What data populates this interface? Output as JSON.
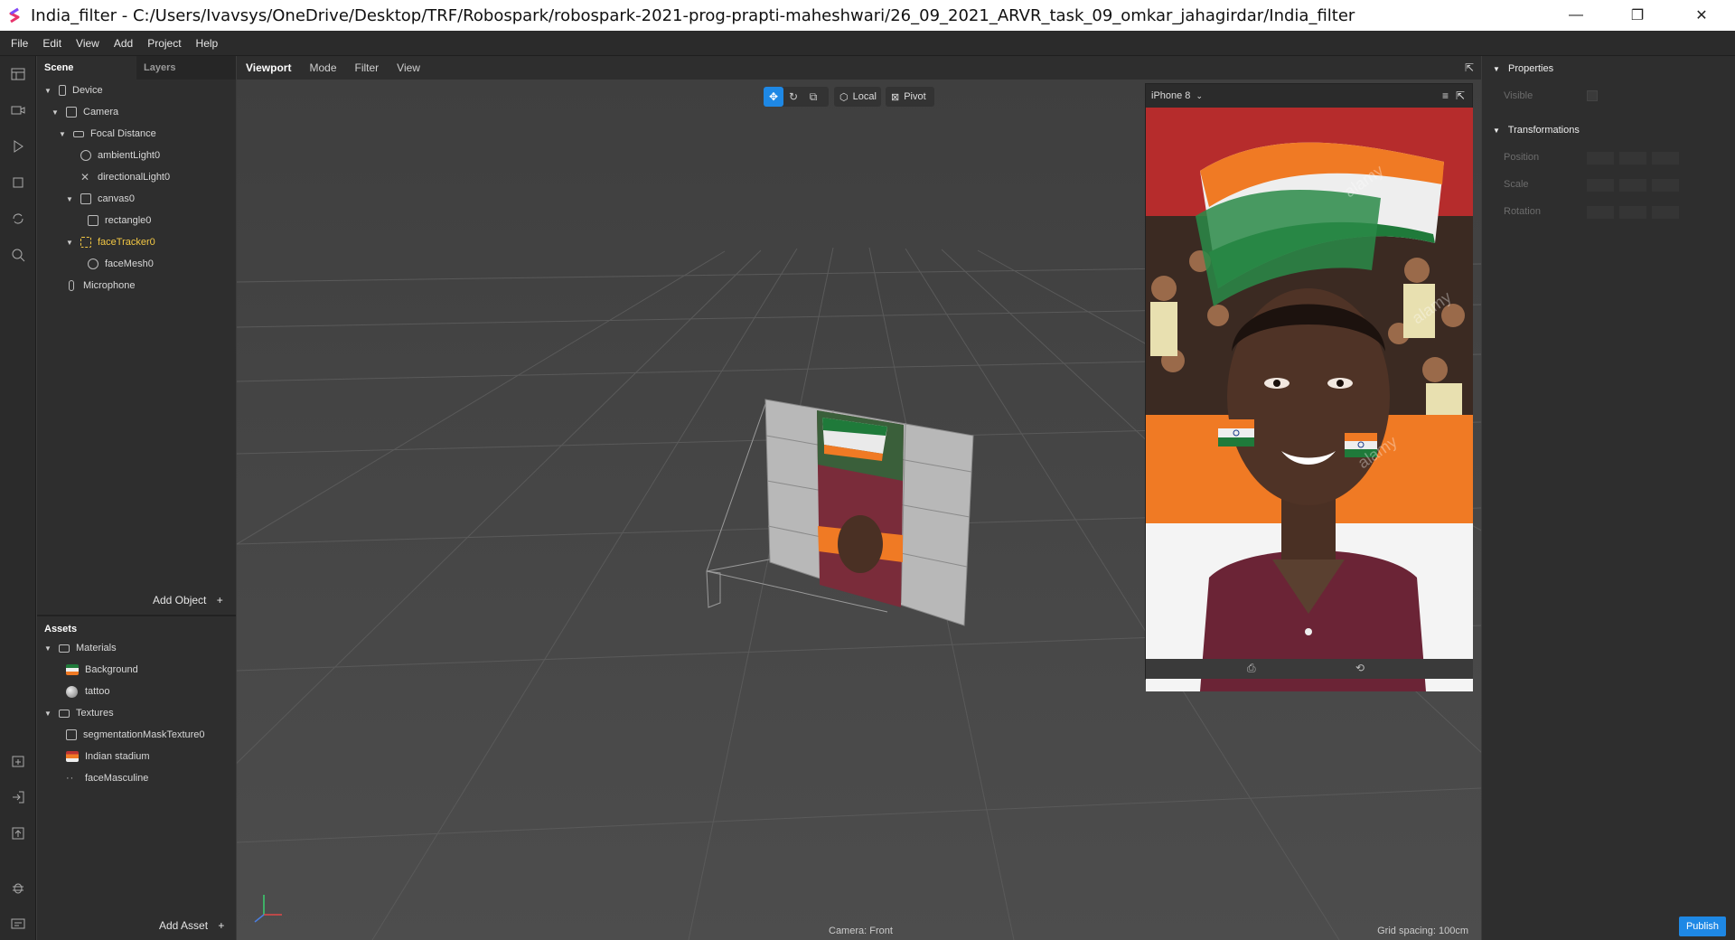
{
  "window": {
    "title": "India_filter - C:/Users/Ivavsys/OneDrive/Desktop/TRF/Robospark/robospark-2021-prog-prapti-maheshwari/26_09_2021_ARVR_task_09_omkar_jahagirdar/India_filter",
    "minimize": "—",
    "restore": "❐",
    "close": "✕"
  },
  "menu": [
    "File",
    "Edit",
    "View",
    "Add",
    "Project",
    "Help"
  ],
  "scene_panel": {
    "tabs": [
      "Scene",
      "Layers"
    ],
    "tree": [
      {
        "label": "Device",
        "icon": "device-icon"
      },
      {
        "label": "Camera",
        "icon": "camera-icon"
      },
      {
        "label": "Focal Distance",
        "icon": "focal-distance-icon"
      },
      {
        "label": "ambientLight0",
        "icon": "ambient-light-icon"
      },
      {
        "label": "directionalLight0",
        "icon": "directional-light-icon"
      },
      {
        "label": "canvas0",
        "icon": "canvas-icon"
      },
      {
        "label": "rectangle0",
        "icon": "rectangle-icon"
      },
      {
        "label": "faceTracker0",
        "icon": "face-tracker-icon"
      },
      {
        "label": "faceMesh0",
        "icon": "face-mesh-icon"
      },
      {
        "label": "Microphone",
        "icon": "microphone-icon"
      }
    ],
    "add_object": "Add Object",
    "add_object_plus": "+"
  },
  "assets_panel": {
    "title": "Assets",
    "items": [
      {
        "label": "Materials",
        "icon": "folder-icon"
      },
      {
        "label": "Background",
        "icon": "material-thumbnail-icon"
      },
      {
        "label": "tattoo",
        "icon": "material-sphere-icon"
      },
      {
        "label": "Textures",
        "icon": "folder-icon"
      },
      {
        "label": "segmentationMaskTexture0",
        "icon": "texture-icon"
      },
      {
        "label": "Indian stadium",
        "icon": "texture-thumbnail-icon"
      },
      {
        "label": "faceMasculine",
        "icon": "texture-dots-icon"
      }
    ],
    "add_asset": "Add Asset",
    "add_asset_plus": "+"
  },
  "viewport": {
    "tabs": [
      "Viewport",
      "Mode",
      "Filter",
      "View"
    ],
    "gizmo": {
      "local": "Local",
      "pivot": "Pivot"
    },
    "camera_status": "Camera: Front",
    "grid_spacing": "Grid spacing: 100cm"
  },
  "simulator": {
    "device": "iPhone 8",
    "watermark": "alamy"
  },
  "properties": {
    "title": "Properties",
    "visible_label": "Visible",
    "transformations_title": "Transformations",
    "rows": [
      "Position",
      "Scale",
      "Rotation"
    ]
  },
  "publish": "Publish",
  "colors": {
    "accent": "#1e88e5",
    "selected_text": "#f2c744",
    "panel_bg": "#2e2e2e",
    "viewport_bg": "#4a4a4a",
    "saffron": "#f07a24",
    "india_green": "#1f7a3a",
    "shirt_maroon": "#6b2436"
  }
}
